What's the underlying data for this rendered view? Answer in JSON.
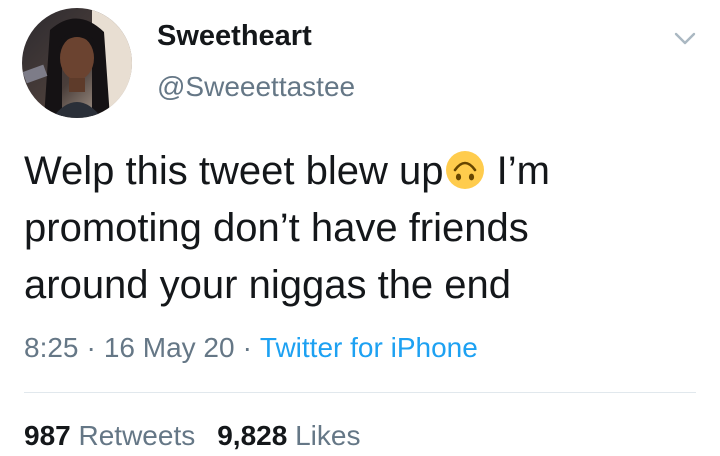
{
  "tweet": {
    "display_name": "Sweetheart",
    "handle": "@Sweeettastee",
    "text_before_emoji": "Welp this tweet blew up",
    "emoji_icon": "upside-down-face-emoji",
    "text_after_emoji": " I’m promoting don’t have friends around your niggas the end",
    "time": "8:25",
    "separator": "·",
    "date": "16 May 20",
    "source": "Twitter for iPhone",
    "retweet_count": "987",
    "retweet_label": "Retweets",
    "like_count": "9,828",
    "like_label": "Likes"
  },
  "colors": {
    "text": "#14171a",
    "secondary": "#657786",
    "link": "#1da1f2",
    "divider": "#e1e8ed"
  },
  "icons": {
    "more": "chevron-down-icon",
    "avatar": "avatar-photo"
  }
}
